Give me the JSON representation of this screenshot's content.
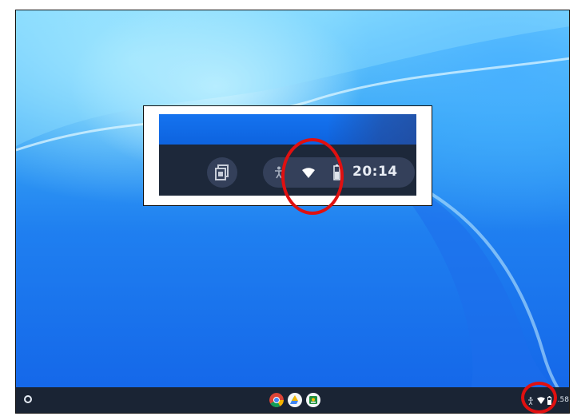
{
  "desktop": {
    "shelf": {
      "launcher_icon": "launcher-circle-icon",
      "apps": [
        "chrome-icon",
        "google-drive-icon",
        "google-classroom-icon"
      ],
      "tray_time": ".58",
      "tray_icons": [
        "accessibility-icon",
        "wifi-icon",
        "battery-icon"
      ]
    }
  },
  "zoom_inset": {
    "time": "20:14",
    "icons": [
      "screen-capture-icon",
      "accessibility-icon",
      "wifi-icon",
      "battery-icon"
    ]
  },
  "colors": {
    "highlight": "#e01010",
    "shelf": "#1a2434",
    "wallpaper_top": "#77d3ff",
    "wallpaper_bottom": "#1364e8"
  }
}
